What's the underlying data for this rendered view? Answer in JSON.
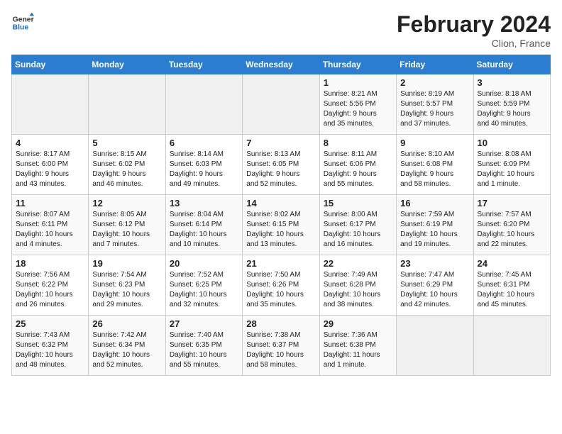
{
  "header": {
    "logo_general": "General",
    "logo_blue": "Blue",
    "month_year": "February 2024",
    "location": "Clion, France"
  },
  "days_of_week": [
    "Sunday",
    "Monday",
    "Tuesday",
    "Wednesday",
    "Thursday",
    "Friday",
    "Saturday"
  ],
  "weeks": [
    [
      {
        "num": "",
        "info": ""
      },
      {
        "num": "",
        "info": ""
      },
      {
        "num": "",
        "info": ""
      },
      {
        "num": "",
        "info": ""
      },
      {
        "num": "1",
        "info": "Sunrise: 8:21 AM\nSunset: 5:56 PM\nDaylight: 9 hours\nand 35 minutes."
      },
      {
        "num": "2",
        "info": "Sunrise: 8:19 AM\nSunset: 5:57 PM\nDaylight: 9 hours\nand 37 minutes."
      },
      {
        "num": "3",
        "info": "Sunrise: 8:18 AM\nSunset: 5:59 PM\nDaylight: 9 hours\nand 40 minutes."
      }
    ],
    [
      {
        "num": "4",
        "info": "Sunrise: 8:17 AM\nSunset: 6:00 PM\nDaylight: 9 hours\nand 43 minutes."
      },
      {
        "num": "5",
        "info": "Sunrise: 8:15 AM\nSunset: 6:02 PM\nDaylight: 9 hours\nand 46 minutes."
      },
      {
        "num": "6",
        "info": "Sunrise: 8:14 AM\nSunset: 6:03 PM\nDaylight: 9 hours\nand 49 minutes."
      },
      {
        "num": "7",
        "info": "Sunrise: 8:13 AM\nSunset: 6:05 PM\nDaylight: 9 hours\nand 52 minutes."
      },
      {
        "num": "8",
        "info": "Sunrise: 8:11 AM\nSunset: 6:06 PM\nDaylight: 9 hours\nand 55 minutes."
      },
      {
        "num": "9",
        "info": "Sunrise: 8:10 AM\nSunset: 6:08 PM\nDaylight: 9 hours\nand 58 minutes."
      },
      {
        "num": "10",
        "info": "Sunrise: 8:08 AM\nSunset: 6:09 PM\nDaylight: 10 hours\nand 1 minute."
      }
    ],
    [
      {
        "num": "11",
        "info": "Sunrise: 8:07 AM\nSunset: 6:11 PM\nDaylight: 10 hours\nand 4 minutes."
      },
      {
        "num": "12",
        "info": "Sunrise: 8:05 AM\nSunset: 6:12 PM\nDaylight: 10 hours\nand 7 minutes."
      },
      {
        "num": "13",
        "info": "Sunrise: 8:04 AM\nSunset: 6:14 PM\nDaylight: 10 hours\nand 10 minutes."
      },
      {
        "num": "14",
        "info": "Sunrise: 8:02 AM\nSunset: 6:15 PM\nDaylight: 10 hours\nand 13 minutes."
      },
      {
        "num": "15",
        "info": "Sunrise: 8:00 AM\nSunset: 6:17 PM\nDaylight: 10 hours\nand 16 minutes."
      },
      {
        "num": "16",
        "info": "Sunrise: 7:59 AM\nSunset: 6:19 PM\nDaylight: 10 hours\nand 19 minutes."
      },
      {
        "num": "17",
        "info": "Sunrise: 7:57 AM\nSunset: 6:20 PM\nDaylight: 10 hours\nand 22 minutes."
      }
    ],
    [
      {
        "num": "18",
        "info": "Sunrise: 7:56 AM\nSunset: 6:22 PM\nDaylight: 10 hours\nand 26 minutes."
      },
      {
        "num": "19",
        "info": "Sunrise: 7:54 AM\nSunset: 6:23 PM\nDaylight: 10 hours\nand 29 minutes."
      },
      {
        "num": "20",
        "info": "Sunrise: 7:52 AM\nSunset: 6:25 PM\nDaylight: 10 hours\nand 32 minutes."
      },
      {
        "num": "21",
        "info": "Sunrise: 7:50 AM\nSunset: 6:26 PM\nDaylight: 10 hours\nand 35 minutes."
      },
      {
        "num": "22",
        "info": "Sunrise: 7:49 AM\nSunset: 6:28 PM\nDaylight: 10 hours\nand 38 minutes."
      },
      {
        "num": "23",
        "info": "Sunrise: 7:47 AM\nSunset: 6:29 PM\nDaylight: 10 hours\nand 42 minutes."
      },
      {
        "num": "24",
        "info": "Sunrise: 7:45 AM\nSunset: 6:31 PM\nDaylight: 10 hours\nand 45 minutes."
      }
    ],
    [
      {
        "num": "25",
        "info": "Sunrise: 7:43 AM\nSunset: 6:32 PM\nDaylight: 10 hours\nand 48 minutes."
      },
      {
        "num": "26",
        "info": "Sunrise: 7:42 AM\nSunset: 6:34 PM\nDaylight: 10 hours\nand 52 minutes."
      },
      {
        "num": "27",
        "info": "Sunrise: 7:40 AM\nSunset: 6:35 PM\nDaylight: 10 hours\nand 55 minutes."
      },
      {
        "num": "28",
        "info": "Sunrise: 7:38 AM\nSunset: 6:37 PM\nDaylight: 10 hours\nand 58 minutes."
      },
      {
        "num": "29",
        "info": "Sunrise: 7:36 AM\nSunset: 6:38 PM\nDaylight: 11 hours\nand 1 minute."
      },
      {
        "num": "",
        "info": ""
      },
      {
        "num": "",
        "info": ""
      }
    ]
  ]
}
